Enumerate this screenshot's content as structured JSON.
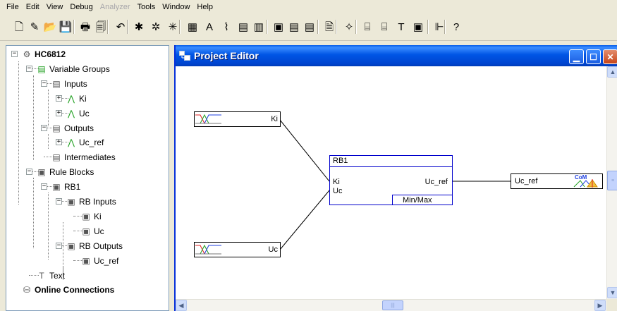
{
  "menu": {
    "items": [
      {
        "label": "File",
        "enabled": true
      },
      {
        "label": "Edit",
        "enabled": true
      },
      {
        "label": "View",
        "enabled": true
      },
      {
        "label": "Debug",
        "enabled": true
      },
      {
        "label": "Analyzer",
        "enabled": false
      },
      {
        "label": "Tools",
        "enabled": true
      },
      {
        "label": "Window",
        "enabled": true
      },
      {
        "label": "Help",
        "enabled": true
      }
    ]
  },
  "toolbar": {
    "buttons": [
      {
        "name": "new-file-icon",
        "glyph": "🗋"
      },
      {
        "name": "wizard-icon",
        "glyph": "✎"
      },
      {
        "name": "open-folder-icon",
        "glyph": "📂"
      },
      {
        "name": "save-disk-icon",
        "glyph": "💾"
      },
      {
        "name": "print-icon",
        "glyph": "🖶"
      },
      {
        "name": "print-preview-icon",
        "glyph": "🗐"
      },
      {
        "name": "undo-icon",
        "glyph": "↶"
      },
      {
        "name": "debug-bug-icon",
        "glyph": "✱"
      },
      {
        "name": "debug-bug2-icon",
        "glyph": "✲"
      },
      {
        "name": "debug-bug3-icon",
        "glyph": "✳"
      },
      {
        "name": "table-icon",
        "glyph": "▦"
      },
      {
        "name": "text-icon",
        "glyph": "A"
      },
      {
        "name": "curve-icon",
        "glyph": "⌇"
      },
      {
        "name": "grid-icon",
        "glyph": "▤"
      },
      {
        "name": "bar-chart-icon",
        "glyph": "▥"
      },
      {
        "name": "frame-icon",
        "glyph": "▣"
      },
      {
        "name": "hci-icon",
        "glyph": "▤"
      },
      {
        "name": "hci2-icon",
        "glyph": "▤"
      },
      {
        "name": "properties-icon",
        "glyph": "🗎"
      },
      {
        "name": "star-tool-icon",
        "glyph": "✧"
      },
      {
        "name": "analyze-icon",
        "glyph": "⌸"
      },
      {
        "name": "variables-icon",
        "glyph": "⌸"
      },
      {
        "name": "text-tool-icon",
        "glyph": "T"
      },
      {
        "name": "monitor-icon",
        "glyph": "▣"
      },
      {
        "name": "tree-view-icon",
        "glyph": "⊩"
      },
      {
        "name": "help-icon",
        "glyph": "?"
      }
    ]
  },
  "tree": {
    "nodes": [
      {
        "label": "HC6812",
        "bold": true,
        "level": 0,
        "expander": "−",
        "icon": "project-icon"
      },
      {
        "label": "Variable Groups",
        "bold": false,
        "level": 1,
        "expander": "−",
        "icon": "variable-groups-icon"
      },
      {
        "label": "Inputs",
        "bold": false,
        "level": 2,
        "expander": "−",
        "icon": "inputs-group-icon"
      },
      {
        "label": "Ki",
        "bold": false,
        "level": 3,
        "expander": "+",
        "icon": "input-variable-icon"
      },
      {
        "label": "Uc",
        "bold": false,
        "level": 3,
        "expander": "+",
        "icon": "input-variable-icon"
      },
      {
        "label": "Outputs",
        "bold": false,
        "level": 2,
        "expander": "−",
        "icon": "outputs-group-icon"
      },
      {
        "label": "Uc_ref",
        "bold": false,
        "level": 3,
        "expander": "+",
        "icon": "output-variable-icon"
      },
      {
        "label": "Intermediates",
        "bold": false,
        "level": 2,
        "expander": "",
        "icon": "intermediates-group-icon"
      },
      {
        "label": "Rule Blocks",
        "bold": false,
        "level": 1,
        "expander": "−",
        "icon": "rule-blocks-icon"
      },
      {
        "label": "RB1",
        "bold": false,
        "level": 2,
        "expander": "−",
        "icon": "rule-block-icon"
      },
      {
        "label": "RB Inputs",
        "bold": false,
        "level": 3,
        "expander": "−",
        "icon": "rb-inputs-icon"
      },
      {
        "label": "Ki",
        "bold": false,
        "level": 4,
        "expander": "",
        "icon": "rb-input-icon"
      },
      {
        "label": "Uc",
        "bold": false,
        "level": 4,
        "expander": "",
        "icon": "rb-input-icon"
      },
      {
        "label": "RB Outputs",
        "bold": false,
        "level": 3,
        "expander": "−",
        "icon": "rb-outputs-icon"
      },
      {
        "label": "Uc_ref",
        "bold": false,
        "level": 4,
        "expander": "",
        "icon": "rb-output-icon"
      },
      {
        "label": "Text",
        "bold": false,
        "level": 1,
        "expander": "",
        "icon": "text-icon"
      },
      {
        "label": "Online Connections",
        "bold": true,
        "level": 0,
        "expander": "",
        "icon": "online-connections-icon"
      }
    ]
  },
  "editor": {
    "title": "Project Editor",
    "var_ki": "Ki",
    "var_uc": "Uc",
    "rule_block": {
      "name": "RB1",
      "input1": "Ki",
      "input2": "Uc",
      "output": "Uc_ref",
      "operator": "Min/Max"
    },
    "out_var": "Uc_ref",
    "out_var_badge": "CoM"
  },
  "colors": {
    "titlebar": "#0055e5",
    "rule_block_border": "#0000cc",
    "term_red": "#e02020",
    "term_green": "#20a020",
    "term_blue": "#2040e0"
  }
}
